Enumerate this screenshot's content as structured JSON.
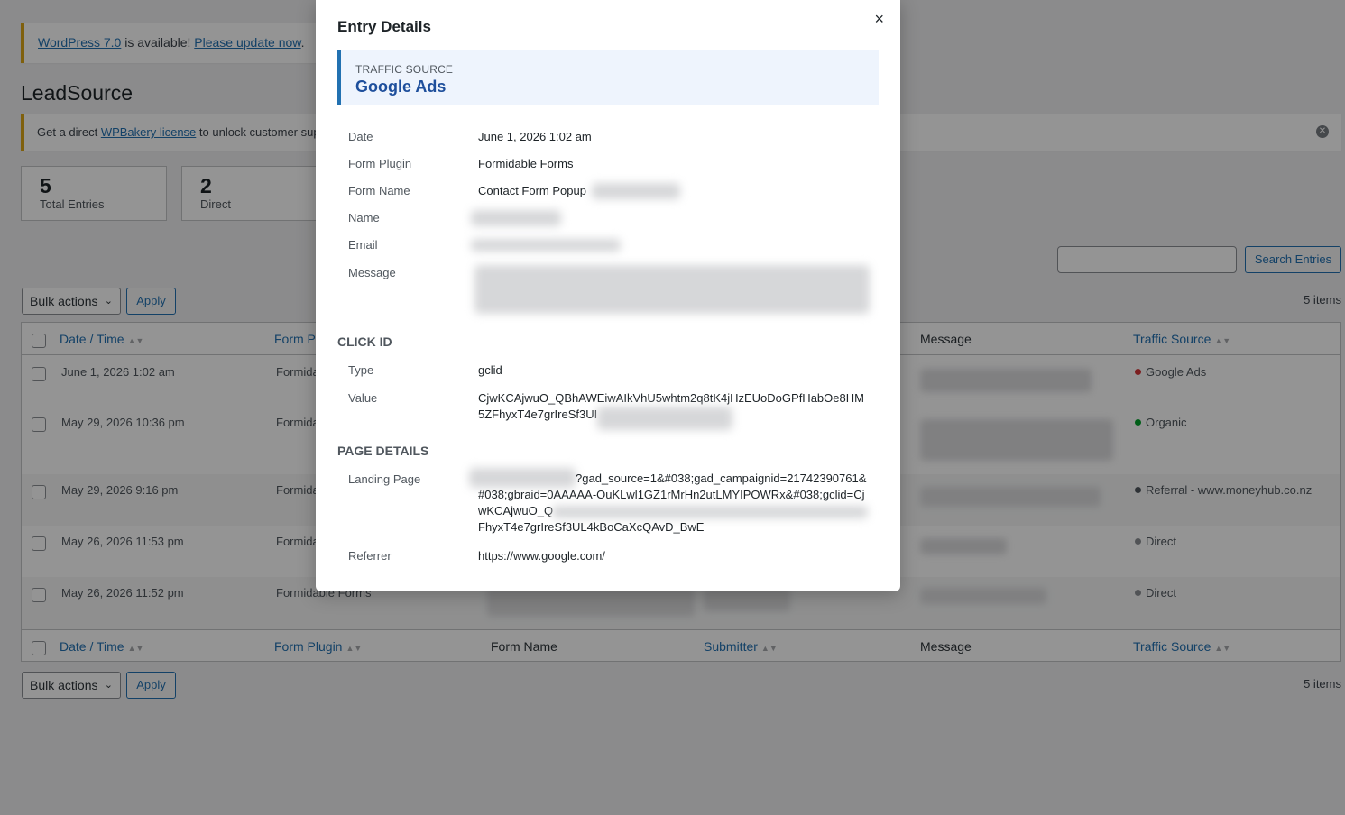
{
  "notice_update": {
    "wp_link": "WordPress 7.0",
    "middle": " is available! ",
    "update_link": "Please update now",
    "end": "."
  },
  "page_title": "LeadSource",
  "notice_wpb": {
    "prefix": "Get a direct ",
    "link": "WPBakery license",
    "suffix": " to unlock customer sup"
  },
  "stats": [
    {
      "num": "5",
      "label": "Total Entries"
    },
    {
      "num": "2",
      "label": "Direct"
    }
  ],
  "search": {
    "button": "Search Entries"
  },
  "bulk": {
    "label": "Bulk actions",
    "apply": "Apply"
  },
  "items_count": "5 items",
  "columns": {
    "date": "Date / Time",
    "form_plugin_partial": "Form P",
    "form_plugin": "Form Plugin",
    "form_name": "Form Name",
    "submitter": "Submitter",
    "message": "Message",
    "traffic_source": "Traffic Source"
  },
  "rows": [
    {
      "date": "June 1, 2026 1:02 am",
      "plugin": "Formida",
      "source": "Google Ads",
      "color": "#d63638"
    },
    {
      "date": "May 29, 2026 10:36 pm",
      "plugin": "Formida",
      "source": "Organic",
      "color": "#00a32a"
    },
    {
      "date": "May 29, 2026 9:16 pm",
      "plugin": "Formida",
      "source": "Referral - www.moneyhub.co.nz",
      "color": "#50575e"
    },
    {
      "date": "May 26, 2026 11:53 pm",
      "plugin": "Formida",
      "source": "Direct",
      "color": "#8c8f94"
    },
    {
      "date": "May 26, 2026 11:52 pm",
      "plugin": "Formidable Forms",
      "source": "Direct",
      "color": "#8c8f94"
    }
  ],
  "modal": {
    "title": "Entry Details",
    "close": "×",
    "traffic_source_label": "Traffic Source",
    "traffic_source_value": "Google Ads",
    "fields": {
      "date_label": "Date",
      "date_value": "June 1, 2026 1:02 am",
      "plugin_label": "Form Plugin",
      "plugin_value": "Formidable Forms",
      "form_label": "Form Name",
      "form_value": "Contact Form Popup",
      "name_label": "Name",
      "email_label": "Email",
      "message_label": "Message"
    },
    "click_id": {
      "heading": "Click ID",
      "type_label": "Type",
      "type_value": "gclid",
      "value_label": "Value",
      "value_value": "CjwKCAjwuO_QBhAWEiwAIkVhU5whtm2q8tK4jHzEUoDoGPfHabOe8HM5ZFhyxT4e7grIreSf3UI"
    },
    "page_details": {
      "heading": "Page Details",
      "landing_label": "Landing Page",
      "landing_line1": "?gad_source=1&#038;gad_campaignid=21742390761&",
      "landing_line2": "#038;gbraid=0AAAAA-OuKLwl1GZ1rMrHn2utLMYIPOWRx&#038;gclid=Cj",
      "landing_line3": "wKCAjwuO_Q",
      "landing_line4": "FhyxT4e7grIreSf3UL4kBoCaXcQAvD_BwE",
      "referrer_label": "Referrer",
      "referrer_value": "https://www.google.com/"
    }
  }
}
